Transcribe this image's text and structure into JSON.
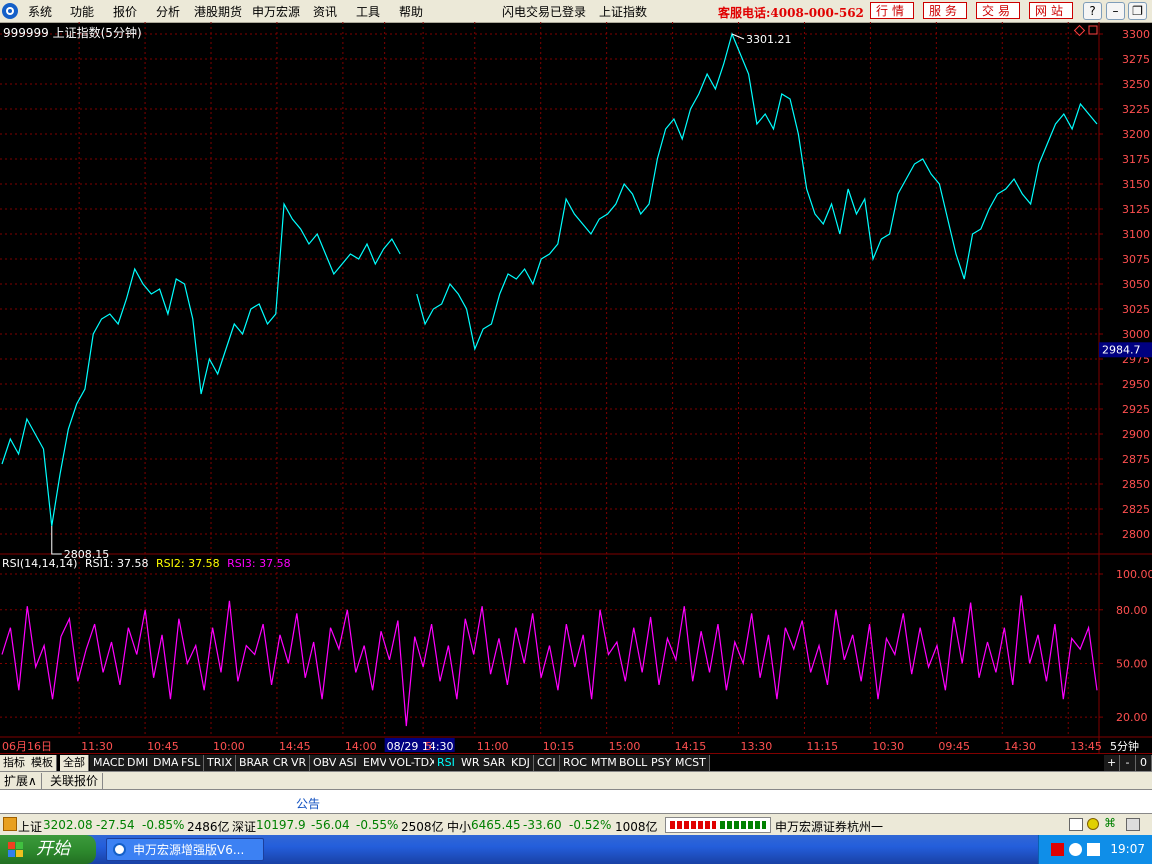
{
  "menu": {
    "items": [
      "系统",
      "功能",
      "报价",
      "分析",
      "港股期货",
      "申万宏源",
      "资讯",
      "工具",
      "帮助"
    ],
    "status1": "闪电交易已登录",
    "status2": "上证指数",
    "hotline": "客服电话:4008-000-562",
    "nav_buttons": [
      "行情",
      "服务",
      "交易",
      "网站"
    ]
  },
  "chart_header": "999999 上证指数(5分钟)",
  "rsi_header": {
    "label": "RSI(14,14,14)",
    "rsi1": "RSI1: 37.58",
    "rsi2": "RSI2: 37.58",
    "rsi3": "RSI3: 37.58"
  },
  "colors": {
    "price_line": "#00ffff",
    "rsi_line": "#ff00ff",
    "grid": "#800000",
    "axis_text": "#ff5050",
    "current_price_box": "#000080",
    "rsi2_color": "#ffff00"
  },
  "chart_data": [
    {
      "type": "line",
      "title": "999999 上证指数(5分钟)",
      "ylim": [
        2790,
        3310
      ],
      "yticks": [
        2800,
        2825,
        2850,
        2875,
        2900,
        2925,
        2950,
        2975,
        3000,
        3025,
        3050,
        3075,
        3100,
        3125,
        3150,
        3175,
        3200,
        3225,
        3250,
        3275,
        3300
      ],
      "x_ticks": [
        "06月16日",
        "11:30",
        "10:45",
        "10:00",
        "14:45",
        "14:00",
        "08/29 14:30",
        "5",
        "11:00",
        "10:15",
        "15:00",
        "14:15",
        "13:30",
        "11:15",
        "10:30",
        "09:45",
        "14:30",
        "13:45"
      ],
      "x_tick_frac": [
        0.0,
        0.072,
        0.132,
        0.192,
        0.252,
        0.312,
        0.35,
        0.385,
        0.432,
        0.492,
        0.552,
        0.612,
        0.672,
        0.732,
        0.792,
        0.852,
        0.912,
        0.972
      ],
      "period_label": "5分钟",
      "max_label": "3301.21",
      "min_label": "2808.15",
      "current_value": "2984.7",
      "series": [
        {
          "values": [
            2870,
            2895,
            2880,
            2915,
            2900,
            2885,
            2808,
            2860,
            2905,
            2930,
            2945,
            3000,
            3015,
            3020,
            3010,
            3035,
            3065,
            3050,
            3040,
            3045,
            3020,
            3055,
            3050,
            3015,
            2940,
            2975,
            2960,
            2985,
            3010,
            3000,
            3025,
            3030,
            3010,
            3020,
            3130,
            3115,
            3105,
            3090,
            3100,
            3080,
            3060,
            3070,
            3080,
            3075,
            3090,
            3070,
            3085,
            3095,
            3080,
            null,
            3040,
            3010,
            3025,
            3030,
            3050,
            3040,
            3025,
            2985,
            3005,
            3010,
            3040,
            3060,
            3055,
            3065,
            3050,
            3075,
            3080,
            3090,
            3135,
            3120,
            3110,
            3100,
            3115,
            3120,
            3130,
            3150,
            3140,
            3120,
            3130,
            3175,
            3205,
            3215,
            3195,
            3225,
            3240,
            3260,
            3245,
            3270,
            3300,
            3280,
            3260,
            3210,
            3220,
            3205,
            3240,
            3235,
            3200,
            3145,
            3120,
            3110,
            3130,
            3100,
            3145,
            3120,
            3135,
            3075,
            3095,
            3100,
            3140,
            3155,
            3170,
            3175,
            3160,
            3150,
            3115,
            3080,
            3055,
            3100,
            3105,
            3125,
            3140,
            3145,
            3155,
            3140,
            3130,
            3170,
            3190,
            3210,
            3220,
            3205,
            3230,
            3220,
            3210
          ]
        }
      ]
    },
    {
      "type": "line",
      "title": "RSI(14,14,14)",
      "ylim": [
        10,
        100
      ],
      "yticks": [
        20,
        50,
        80,
        100
      ],
      "series": [
        {
          "name": "RSI1",
          "values": [
            55,
            70,
            35,
            82,
            48,
            60,
            30,
            65,
            75,
            40,
            58,
            72,
            45,
            62,
            38,
            70,
            55,
            80,
            42,
            66,
            30,
            75,
            50,
            60,
            35,
            70,
            45,
            85,
            40,
            60,
            55,
            72,
            38,
            66,
            50,
            78,
            42,
            62,
            30,
            70,
            58,
            80,
            45,
            60,
            35,
            68,
            52,
            74,
            15,
            65,
            48,
            72,
            40,
            60,
            30,
            75,
            55,
            82,
            44,
            64,
            38,
            70,
            50,
            78,
            42,
            60,
            35,
            72,
            48,
            66,
            30,
            80,
            55,
            62,
            40,
            70,
            45,
            76,
            38,
            64,
            52,
            82,
            40,
            68,
            45,
            72,
            35,
            62,
            50,
            78,
            42,
            66,
            30,
            70,
            58,
            74,
            45,
            60,
            38,
            80,
            52,
            66,
            40,
            72,
            30,
            64,
            55,
            78,
            44,
            70,
            48,
            60,
            35,
            76,
            50,
            84,
            42,
            62,
            45,
            70,
            38,
            88,
            50,
            66,
            40,
            72,
            30,
            64,
            58,
            70,
            35
          ]
        }
      ]
    }
  ],
  "toolbar": {
    "indicators": [
      "指标",
      "模板",
      "全部",
      "MACD",
      "DMI",
      "DMA",
      "FSL",
      "TRIX",
      "BRAR",
      "CR",
      "VR",
      "OBV",
      "ASI",
      "EMV",
      "VOL-TDX",
      "RSI",
      "WR",
      "SAR",
      "KDJ",
      "CCI",
      "ROC",
      "MTM",
      "BOLL",
      "PSY",
      "MCST"
    ],
    "right_controls": [
      "+",
      "-",
      "0"
    ]
  },
  "tabs": [
    "扩展∧",
    "关联报价"
  ],
  "notice": "公告",
  "ticker": {
    "sh_label": "上证",
    "sh_value": "3202.08",
    "sh_change": "-27.54",
    "sh_pct": "-0.85%",
    "sh_volume": "2486亿",
    "sz_label": "深证",
    "sz_value": "10197.9",
    "sz_change": "-56.04",
    "sz_pct": "-0.55%",
    "sz_volume": "2508亿",
    "zx_label": "中小",
    "zx_value": "6465.45",
    "zx_change": "-33.60",
    "zx_pct": "-0.52%",
    "zx_volume": "1008亿",
    "broker": "申万宏源证券杭州一"
  },
  "taskbar": {
    "start": "开始",
    "task": "申万宏源增强版V6...",
    "clock": "19:07"
  }
}
